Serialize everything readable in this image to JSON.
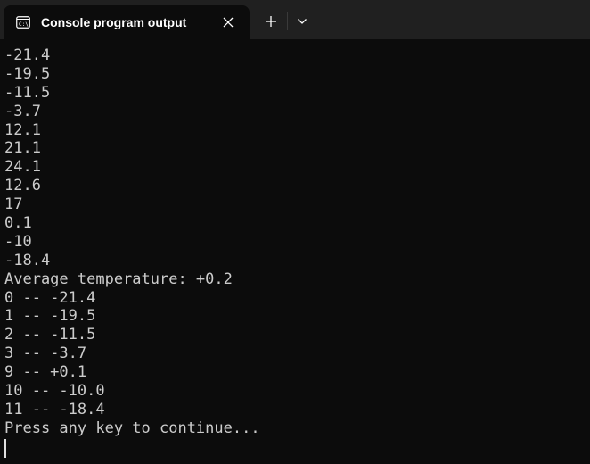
{
  "tab": {
    "title": "Console program output",
    "icon": "console-icon"
  },
  "controls": {
    "close_icon": "close-icon",
    "new_tab_icon": "plus-icon",
    "dropdown_icon": "chevron-down-icon"
  },
  "console": {
    "lines": [
      "-21.4",
      "-19.5",
      "-11.5",
      "-3.7",
      "12.1",
      "21.1",
      "24.1",
      "12.6",
      "17",
      "0.1",
      "-10",
      "-18.4",
      "Average temperature: +0.2",
      "0 -- -21.4",
      "1 -- -19.5",
      "2 -- -11.5",
      "3 -- -3.7",
      "9 -- +0.1",
      "10 -- -10.0",
      "11 -- -18.4",
      "Press any key to continue..."
    ]
  },
  "colors": {
    "background": "#0c0c0c",
    "tabbar": "#202020",
    "text": "#cccccc"
  }
}
